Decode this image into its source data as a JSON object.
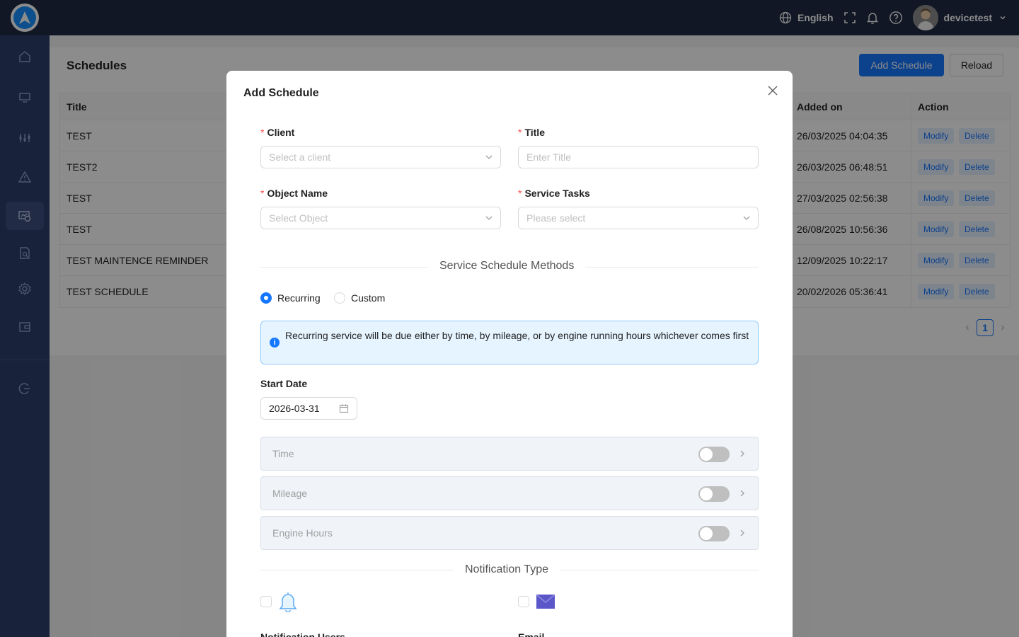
{
  "topbar": {
    "language": "English",
    "username": "devicetest"
  },
  "page": {
    "title": "Schedules",
    "add_button": "Add Schedule",
    "reload_button": "Reload"
  },
  "table": {
    "headers": {
      "title": "Title",
      "added_on": "Added on",
      "action": "Action"
    },
    "rows": [
      {
        "title": "TEST",
        "added_on": "26/03/2025 04:04:35"
      },
      {
        "title": "TEST2",
        "added_on": "26/03/2025 06:48:51"
      },
      {
        "title": "TEST",
        "added_on": "27/03/2025 02:56:38"
      },
      {
        "title": "TEST",
        "added_on": "26/08/2025 10:56:36"
      },
      {
        "title": "TEST MAINTENCE REMINDER",
        "added_on": "12/09/2025 10:22:17"
      },
      {
        "title": "TEST SCHEDULE",
        "added_on": "20/02/2026 05:36:41"
      }
    ],
    "modify_label": "Modify",
    "delete_label": "Delete",
    "current_page": "1"
  },
  "modal": {
    "title": "Add Schedule",
    "client": {
      "label": "Client",
      "placeholder": "Select a client"
    },
    "title_field": {
      "label": "Title",
      "placeholder": "Enter Title"
    },
    "object_name": {
      "label": "Object Name",
      "placeholder": "Select Object"
    },
    "service_tasks": {
      "label": "Service Tasks",
      "placeholder": "Please select"
    },
    "methods_divider": "Service Schedule Methods",
    "recurring_label": "Recurring",
    "custom_label": "Custom",
    "selected_method": "Recurring",
    "info_text": "Recurring service will be due either by time, by mileage, or by engine running hours whichever comes first",
    "start_date_label": "Start Date",
    "start_date_value": "2026-03-31",
    "panels": [
      {
        "label": "Time",
        "enabled": false
      },
      {
        "label": "Mileage",
        "enabled": false
      },
      {
        "label": "Engine Hours",
        "enabled": false
      }
    ],
    "notification_divider": "Notification Type",
    "notification_users_label": "Notification Users",
    "email_label": "Email"
  },
  "colors": {
    "primary": "#1677ff",
    "topbar": "#1f2a44",
    "sidebar": "#2e3e6c",
    "required": "#ff4d4f"
  }
}
